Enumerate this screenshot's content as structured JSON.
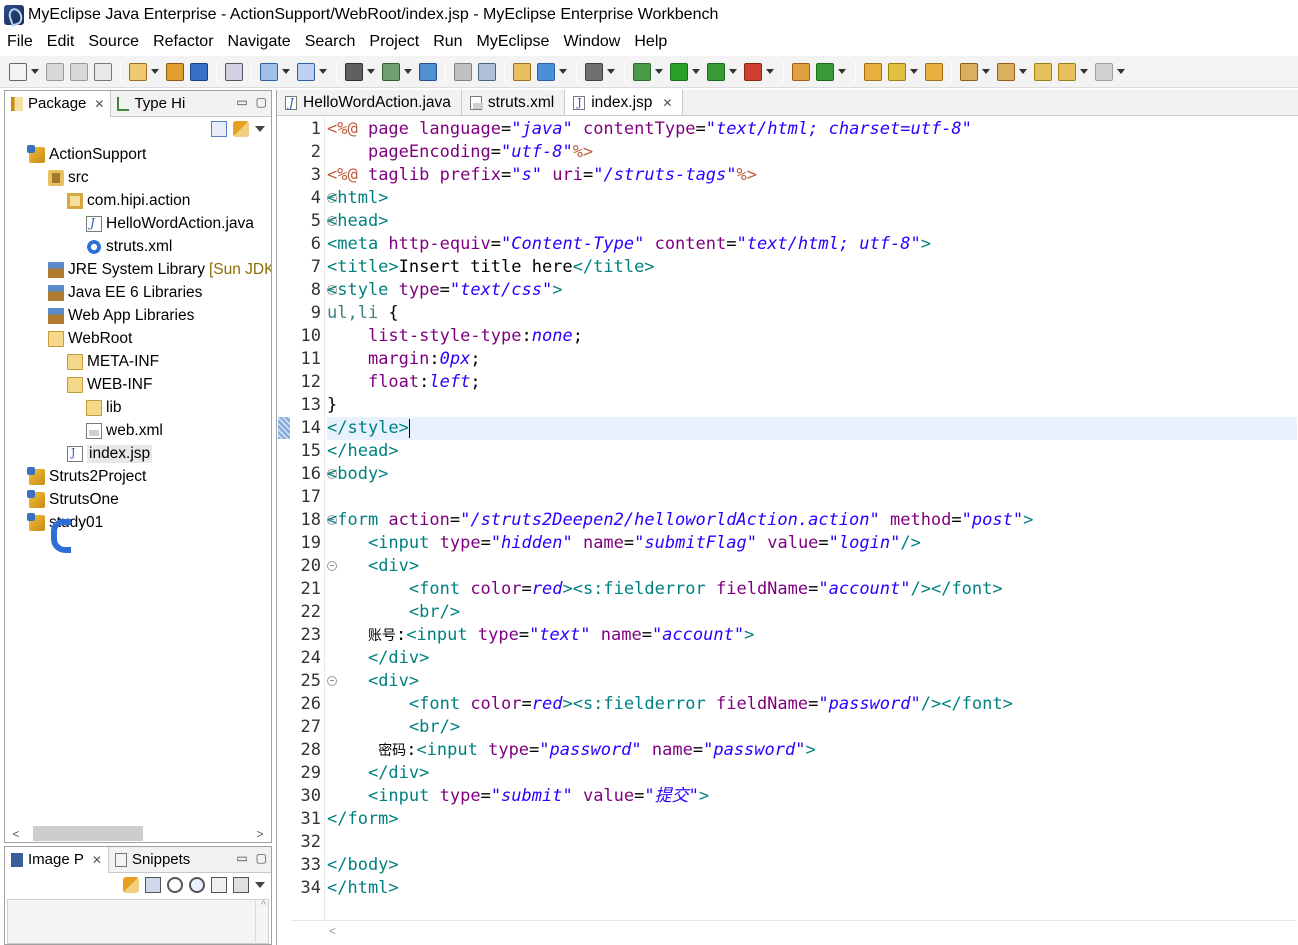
{
  "window": {
    "title": "MyEclipse Java Enterprise - ActionSupport/WebRoot/index.jsp - MyEclipse Enterprise Workbench"
  },
  "menu": [
    "File",
    "Edit",
    "Source",
    "Refactor",
    "Navigate",
    "Search",
    "Project",
    "Run",
    "MyEclipse",
    "Window",
    "Help"
  ],
  "left_panel": {
    "tabs": [
      {
        "label": "Package",
        "close": "✕"
      },
      {
        "label": "Type Hi",
        "close": ""
      }
    ],
    "controls": {
      "minimize": "▭",
      "maximize": "▢"
    },
    "tree": [
      {
        "label": "ActionSupport",
        "icon": "project-icon",
        "depth": 0
      },
      {
        "label": "src",
        "icon": "source-folder-icon",
        "depth": 1
      },
      {
        "label": "com.hipi.action",
        "icon": "package-icon",
        "depth": 2
      },
      {
        "label": "HelloWordAction.java",
        "icon": "java-file-icon",
        "depth": 3
      },
      {
        "label": "struts.xml",
        "icon": "gear-icon",
        "depth": 3
      },
      {
        "label": "JRE System Library",
        "decoration": "[Sun JDK",
        "icon": "library-icon",
        "depth": 1
      },
      {
        "label": "Java EE 6 Libraries",
        "icon": "library-icon",
        "depth": 1
      },
      {
        "label": "Web App Libraries",
        "icon": "library-icon",
        "depth": 1
      },
      {
        "label": "WebRoot",
        "icon": "folder-icon",
        "depth": 1
      },
      {
        "label": "META-INF",
        "icon": "folder-icon",
        "depth": 2
      },
      {
        "label": "WEB-INF",
        "icon": "folder-icon",
        "depth": 2
      },
      {
        "label": "lib",
        "icon": "folder-icon",
        "depth": 3
      },
      {
        "label": "web.xml",
        "icon": "xml-file-icon",
        "depth": 3
      },
      {
        "label": "index.jsp",
        "icon": "jsp-file-icon",
        "depth": 2,
        "selected": true
      },
      {
        "label": "Struts2Project",
        "icon": "project-icon",
        "depth": 0
      },
      {
        "label": "StrutsOne",
        "icon": "project-icon",
        "depth": 0
      },
      {
        "label": "study01",
        "icon": "project-icon",
        "depth": 0
      }
    ],
    "hscroll": {
      "left": "<",
      "right": ">"
    }
  },
  "bottom_left_panel": {
    "tabs": [
      {
        "label": "Image P",
        "close": "✕"
      },
      {
        "label": "Snippets",
        "close": ""
      }
    ],
    "scroll_up": "^"
  },
  "editor": {
    "tabs": [
      {
        "label": "HelloWordAction.java",
        "active": false,
        "close": ""
      },
      {
        "label": "struts.xml",
        "active": false,
        "close": ""
      },
      {
        "label": "index.jsp",
        "active": true,
        "close": "✕"
      }
    ],
    "current_line": 14,
    "fold_lines": [
      4,
      5,
      8,
      16,
      18,
      20,
      25
    ],
    "lines": [
      [
        [
          "dl",
          "<%@ "
        ],
        [
          "an",
          "page "
        ],
        [
          "an",
          "language"
        ],
        [
          "tx",
          "="
        ],
        [
          "av",
          "\"java\""
        ],
        [
          "tx",
          " "
        ],
        [
          "an",
          "contentType"
        ],
        [
          "tx",
          "="
        ],
        [
          "av",
          "\"text/html; charset=utf-8\""
        ]
      ],
      [
        [
          "tx",
          "    "
        ],
        [
          "an",
          "pageEncoding"
        ],
        [
          "tx",
          "="
        ],
        [
          "av",
          "\"utf-8\""
        ],
        [
          "dl",
          "%>"
        ]
      ],
      [
        [
          "dl",
          "<%@ "
        ],
        [
          "an",
          "taglib "
        ],
        [
          "an",
          "prefix"
        ],
        [
          "tx",
          "="
        ],
        [
          "av",
          "\"s\""
        ],
        [
          "tx",
          " "
        ],
        [
          "an",
          "uri"
        ],
        [
          "tx",
          "="
        ],
        [
          "av",
          "\"/struts-tags\""
        ],
        [
          "dl",
          "%>"
        ]
      ],
      [
        [
          "tg",
          "<html>"
        ]
      ],
      [
        [
          "tg",
          "<head>"
        ]
      ],
      [
        [
          "tg",
          "<meta "
        ],
        [
          "an",
          "http-equiv"
        ],
        [
          "tx",
          "="
        ],
        [
          "av",
          "\"Content-Type\""
        ],
        [
          "tx",
          " "
        ],
        [
          "an",
          "content"
        ],
        [
          "tx",
          "="
        ],
        [
          "av",
          "\"text/html; utf-8\""
        ],
        [
          "tg",
          ">"
        ]
      ],
      [
        [
          "tg",
          "<title>"
        ],
        [
          "tx",
          "Insert title here"
        ],
        [
          "tg",
          "</title>"
        ]
      ],
      [
        [
          "tg",
          "<style "
        ],
        [
          "an",
          "type"
        ],
        [
          "tx",
          "="
        ],
        [
          "av",
          "\"text/css\""
        ],
        [
          "tg",
          ">"
        ]
      ],
      [
        [
          "cs-sel",
          "ul,li "
        ],
        [
          "tx",
          "{"
        ]
      ],
      [
        [
          "tx",
          "    "
        ],
        [
          "cs-prop",
          "list-style-type"
        ],
        [
          "tx",
          ":"
        ],
        [
          "cs-val",
          "none"
        ],
        [
          "tx",
          ";"
        ]
      ],
      [
        [
          "tx",
          "    "
        ],
        [
          "cs-prop",
          "margin"
        ],
        [
          "tx",
          ":"
        ],
        [
          "cs-val",
          "0px"
        ],
        [
          "tx",
          ";"
        ]
      ],
      [
        [
          "tx",
          "    "
        ],
        [
          "cs-prop",
          "float"
        ],
        [
          "tx",
          ":"
        ],
        [
          "cs-val",
          "left"
        ],
        [
          "tx",
          ";"
        ]
      ],
      [
        [
          "tx",
          "}"
        ]
      ],
      [
        [
          "tg",
          "</style>"
        ]
      ],
      [
        [
          "tg",
          "</head>"
        ]
      ],
      [
        [
          "tg",
          "<body>"
        ]
      ],
      [
        [
          "tx",
          ""
        ]
      ],
      [
        [
          "tg",
          "<form "
        ],
        [
          "an",
          "action"
        ],
        [
          "tx",
          "="
        ],
        [
          "av",
          "\"/struts2Deepen2/helloworldAction.action\""
        ],
        [
          "tx",
          " "
        ],
        [
          "an",
          "method"
        ],
        [
          "tx",
          "="
        ],
        [
          "av",
          "\"post\""
        ],
        [
          "tg",
          ">"
        ]
      ],
      [
        [
          "tx",
          "    "
        ],
        [
          "tg",
          "<input "
        ],
        [
          "an",
          "type"
        ],
        [
          "tx",
          "="
        ],
        [
          "av",
          "\"hidden\""
        ],
        [
          "tx",
          " "
        ],
        [
          "an",
          "name"
        ],
        [
          "tx",
          "="
        ],
        [
          "av",
          "\"submitFlag\""
        ],
        [
          "tx",
          " "
        ],
        [
          "an",
          "value"
        ],
        [
          "tx",
          "="
        ],
        [
          "av",
          "\"login\""
        ],
        [
          "tg",
          "/>"
        ]
      ],
      [
        [
          "tx",
          "    "
        ],
        [
          "tg",
          "<div>"
        ]
      ],
      [
        [
          "tx",
          "        "
        ],
        [
          "tg",
          "<font "
        ],
        [
          "an",
          "color"
        ],
        [
          "tx",
          "="
        ],
        [
          "av",
          "red"
        ],
        [
          "tg",
          "><s:fielderror "
        ],
        [
          "an",
          "fieldName"
        ],
        [
          "tx",
          "="
        ],
        [
          "av",
          "\"account\""
        ],
        [
          "tg",
          "/></font>"
        ]
      ],
      [
        [
          "tx",
          "        "
        ],
        [
          "tg",
          "<br/>"
        ]
      ],
      [
        [
          "tx",
          "    "
        ],
        [
          "cjk",
          "账号"
        ],
        [
          "tx",
          ":"
        ],
        [
          "tg",
          "<input "
        ],
        [
          "an",
          "type"
        ],
        [
          "tx",
          "="
        ],
        [
          "av",
          "\"text\""
        ],
        [
          "tx",
          " "
        ],
        [
          "an",
          "name"
        ],
        [
          "tx",
          "="
        ],
        [
          "av",
          "\"account\""
        ],
        [
          "tg",
          ">"
        ]
      ],
      [
        [
          "tx",
          "    "
        ],
        [
          "tg",
          "</div>"
        ]
      ],
      [
        [
          "tx",
          "    "
        ],
        [
          "tg",
          "<div>"
        ]
      ],
      [
        [
          "tx",
          "        "
        ],
        [
          "tg",
          "<font "
        ],
        [
          "an",
          "color"
        ],
        [
          "tx",
          "="
        ],
        [
          "av",
          "red"
        ],
        [
          "tg",
          "><s:fielderror "
        ],
        [
          "an",
          "fieldName"
        ],
        [
          "tx",
          "="
        ],
        [
          "av",
          "\"password\""
        ],
        [
          "tg",
          "/></font>"
        ]
      ],
      [
        [
          "tx",
          "        "
        ],
        [
          "tg",
          "<br/>"
        ]
      ],
      [
        [
          "tx",
          "     "
        ],
        [
          "cjk",
          "密码"
        ],
        [
          "tx",
          ":"
        ],
        [
          "tg",
          "<input "
        ],
        [
          "an",
          "type"
        ],
        [
          "tx",
          "="
        ],
        [
          "av",
          "\"password\""
        ],
        [
          "tx",
          " "
        ],
        [
          "an",
          "name"
        ],
        [
          "tx",
          "="
        ],
        [
          "av",
          "\"password\""
        ],
        [
          "tg",
          ">"
        ]
      ],
      [
        [
          "tx",
          "    "
        ],
        [
          "tg",
          "</div>"
        ]
      ],
      [
        [
          "tx",
          "    "
        ],
        [
          "tg",
          "<input "
        ],
        [
          "an",
          "type"
        ],
        [
          "tx",
          "="
        ],
        [
          "av",
          "\"submit\""
        ],
        [
          "tx",
          " "
        ],
        [
          "an",
          "value"
        ],
        [
          "tx",
          "="
        ],
        [
          "av",
          "\"提交\""
        ],
        [
          "tg",
          ">"
        ]
      ],
      [
        [
          "tg",
          "</form>"
        ]
      ],
      [
        [
          "tx",
          ""
        ]
      ],
      [
        [
          "tg",
          "</body>"
        ]
      ],
      [
        [
          "tg",
          "</html>"
        ]
      ]
    ],
    "hscroll_left": "<"
  },
  "colors": {
    "tag": "#008080",
    "attribute_name": "#7f007f",
    "attribute_value": "#2a00ff",
    "directive": "#bf5f3f",
    "current_line": "#e8f2fe"
  }
}
